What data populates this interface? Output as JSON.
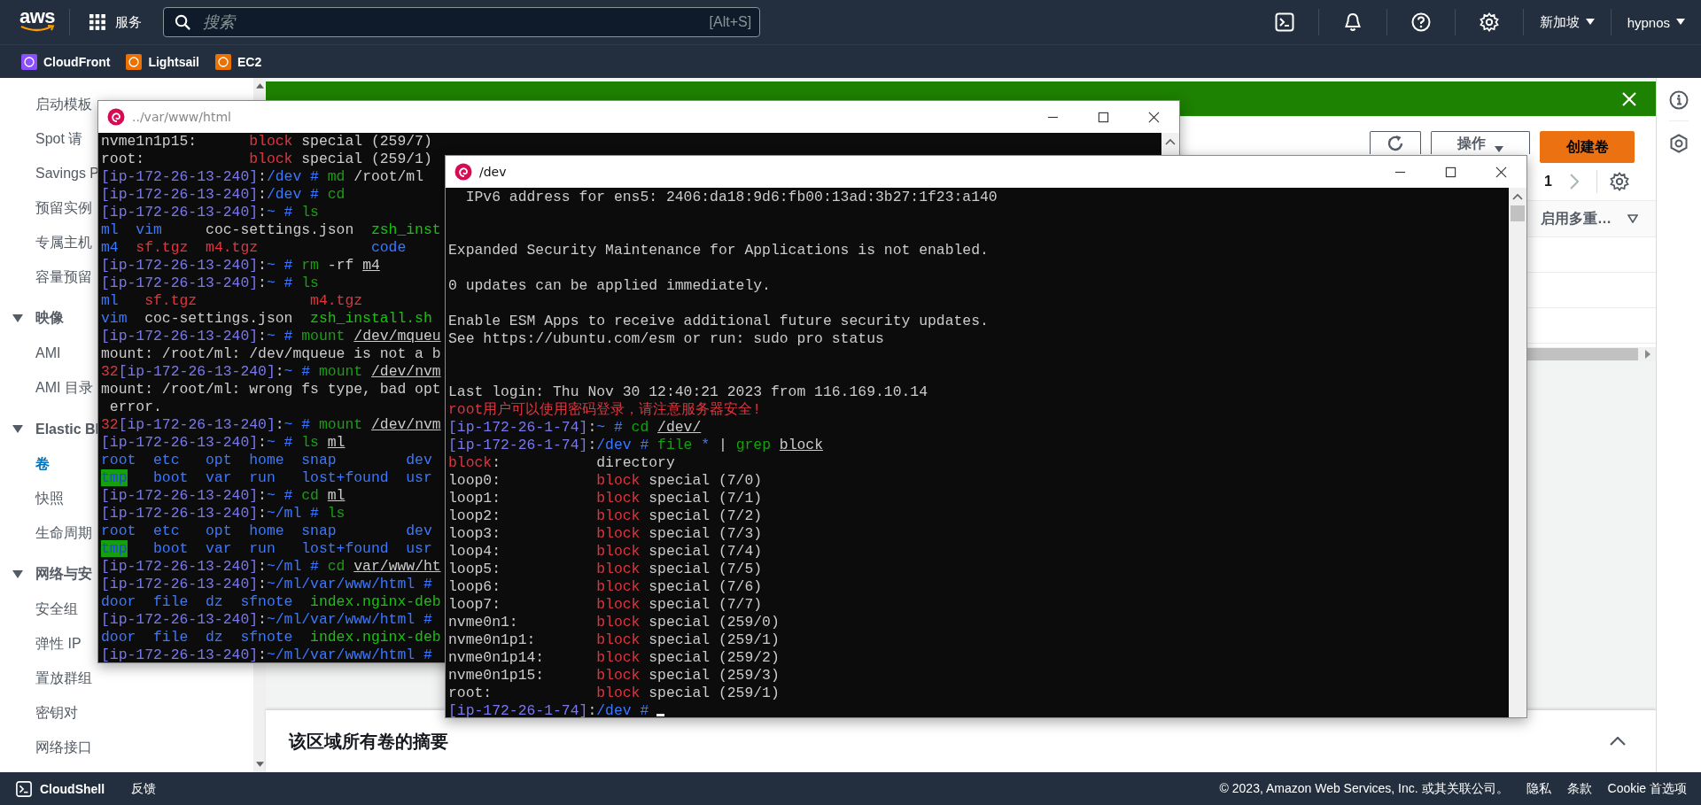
{
  "header": {
    "logo": "aws",
    "services": "服务",
    "search": {
      "placeholder": "搜索",
      "shortcut": "[Alt+S]"
    },
    "region": "新加坡",
    "user": "hypnos"
  },
  "favorites": [
    {
      "label": "CloudFront",
      "color": "#8c4fff"
    },
    {
      "label": "Lightsail",
      "color": "#ed7100"
    },
    {
      "label": "EC2",
      "color": "#ed7100"
    }
  ],
  "sidebar": {
    "items": [
      {
        "kind": "link",
        "label": "启动模板",
        "selected": false
      },
      {
        "kind": "link",
        "label": "Spot 请",
        "selected": false
      },
      {
        "kind": "link",
        "label": "Savings P",
        "selected": false
      },
      {
        "kind": "link",
        "label": "预留实例",
        "selected": false
      },
      {
        "kind": "link",
        "label": "专属主机",
        "selected": false
      },
      {
        "kind": "link",
        "label": "容量预留",
        "selected": false
      },
      {
        "kind": "section",
        "label": "映像",
        "expanded": true
      },
      {
        "kind": "link",
        "label": "AMI",
        "selected": false
      },
      {
        "kind": "link",
        "label": "AMI 目录",
        "selected": false
      },
      {
        "kind": "section",
        "label": "Elastic Bl",
        "expanded": true
      },
      {
        "kind": "link",
        "label": "卷",
        "selected": true
      },
      {
        "kind": "link",
        "label": "快照",
        "selected": false
      },
      {
        "kind": "link",
        "label": "生命周期",
        "selected": false
      },
      {
        "kind": "section",
        "label": "网络与安",
        "expanded": true
      },
      {
        "kind": "link",
        "label": "安全组",
        "selected": false
      },
      {
        "kind": "link",
        "label": "弹性 IP",
        "selected": false
      },
      {
        "kind": "link",
        "label": "置放群组",
        "selected": false
      },
      {
        "kind": "link",
        "label": "密钥对",
        "selected": false
      },
      {
        "kind": "link",
        "label": "网络接口",
        "selected": false
      }
    ]
  },
  "volumes": {
    "actions": "操作",
    "create": "创建卷",
    "page": "1",
    "column": "启用多重…"
  },
  "summary": {
    "title": "该区域所有卷的摘要"
  },
  "footer": {
    "cloudshell": "CloudShell",
    "feedback": "反馈",
    "copyright": "© 2023, Amazon Web Services, Inc. 或其关联公司。",
    "links": [
      "隐私",
      "条款",
      "Cookie 首选项"
    ]
  },
  "terminals": [
    {
      "title": "../var/www/html",
      "active": false,
      "cursor": false,
      "lines": [
        {
          "segs": [
            {
              "kind": "plain",
              "text": "nvme1n1p15:      "
            },
            {
              "kind": "red",
              "text": "block"
            },
            {
              "kind": "plain",
              "text": " special (259/7)"
            }
          ]
        },
        {
          "segs": [
            {
              "kind": "plain",
              "text": "root:            "
            },
            {
              "kind": "red",
              "text": "block"
            },
            {
              "kind": "plain",
              "text": " special (259/1)"
            }
          ]
        },
        {
          "segs": [
            {
              "kind": "prompt",
              "text": "[ip-172-26-13-240]"
            },
            {
              "kind": "plain",
              "text": ":"
            },
            {
              "kind": "path",
              "text": "/dev # "
            },
            {
              "kind": "command",
              "text": "md"
            },
            {
              "kind": "plain",
              "text": " /root/ml"
            }
          ]
        },
        {
          "segs": [
            {
              "kind": "prompt",
              "text": "[ip-172-26-13-240]"
            },
            {
              "kind": "plain",
              "text": ":"
            },
            {
              "kind": "path",
              "text": "/dev # "
            },
            {
              "kind": "command",
              "text": "cd"
            }
          ]
        },
        {
          "segs": [
            {
              "kind": "prompt",
              "text": "[ip-172-26-13-240]"
            },
            {
              "kind": "plain",
              "text": ":"
            },
            {
              "kind": "path",
              "text": "~ # "
            },
            {
              "kind": "command",
              "text": "ls"
            }
          ]
        },
        {
          "segs": [
            {
              "kind": "blue",
              "text": "ml  vim"
            },
            {
              "kind": "plain",
              "text": "     coc-settings.json  "
            },
            {
              "kind": "green",
              "text": "zsh_inst"
            }
          ]
        },
        {
          "segs": [
            {
              "kind": "blue",
              "text": "m4  "
            },
            {
              "kind": "red",
              "text": "sf.tgz  m4.tgz             "
            },
            {
              "kind": "blue",
              "text": "code"
            }
          ]
        },
        {
          "segs": [
            {
              "kind": "prompt",
              "text": "[ip-172-26-13-240]"
            },
            {
              "kind": "plain",
              "text": ":"
            },
            {
              "kind": "path",
              "text": "~ # "
            },
            {
              "kind": "command",
              "text": "rm"
            },
            {
              "kind": "plain",
              "text": " -rf "
            },
            {
              "kind": "underline",
              "text": "m4"
            }
          ]
        },
        {
          "segs": [
            {
              "kind": "prompt",
              "text": "[ip-172-26-13-240]"
            },
            {
              "kind": "plain",
              "text": ":"
            },
            {
              "kind": "path",
              "text": "~ # "
            },
            {
              "kind": "command",
              "text": "ls"
            }
          ]
        },
        {
          "segs": [
            {
              "kind": "blue",
              "text": "ml   "
            },
            {
              "kind": "red",
              "text": "sf.tgz             m4.tgz"
            }
          ]
        },
        {
          "segs": [
            {
              "kind": "blue",
              "text": "vim"
            },
            {
              "kind": "plain",
              "text": "  coc-settings.json  "
            },
            {
              "kind": "green",
              "text": "zsh_install.sh"
            }
          ]
        },
        {
          "segs": [
            {
              "kind": "prompt",
              "text": "[ip-172-26-13-240]"
            },
            {
              "kind": "plain",
              "text": ":"
            },
            {
              "kind": "path",
              "text": "~ # "
            },
            {
              "kind": "command",
              "text": "mount "
            },
            {
              "kind": "underline",
              "text": "/dev/mqueu"
            }
          ]
        },
        {
          "segs": [
            {
              "kind": "plain",
              "text": "mount: /root/ml: /dev/mqueue is not a b"
            }
          ]
        },
        {
          "segs": [
            {
              "kind": "red",
              "text": "32"
            },
            {
              "kind": "prompt",
              "text": "[ip-172-26-13-240]"
            },
            {
              "kind": "plain",
              "text": ":"
            },
            {
              "kind": "path",
              "text": "~ # "
            },
            {
              "kind": "command",
              "text": "mount "
            },
            {
              "kind": "underline",
              "text": "/dev/nvm"
            }
          ]
        },
        {
          "segs": [
            {
              "kind": "plain",
              "text": "mount: /root/ml: wrong fs type, bad opt"
            }
          ]
        },
        {
          "segs": [
            {
              "kind": "plain",
              "text": " error."
            }
          ]
        },
        {
          "segs": [
            {
              "kind": "red",
              "text": "32"
            },
            {
              "kind": "prompt",
              "text": "[ip-172-26-13-240]"
            },
            {
              "kind": "plain",
              "text": ":"
            },
            {
              "kind": "path",
              "text": "~ # "
            },
            {
              "kind": "command",
              "text": "mount "
            },
            {
              "kind": "underline",
              "text": "/dev/nvm"
            }
          ]
        },
        {
          "segs": [
            {
              "kind": "prompt",
              "text": "[ip-172-26-13-240]"
            },
            {
              "kind": "plain",
              "text": ":"
            },
            {
              "kind": "path",
              "text": "~ # "
            },
            {
              "kind": "command",
              "text": "ls "
            },
            {
              "kind": "underline",
              "text": "ml"
            }
          ]
        },
        {
          "segs": [
            {
              "kind": "blue",
              "text": "root  etc   opt  home  snap        dev"
            }
          ]
        },
        {
          "segs": [
            {
              "kind": "highlight",
              "text": "tmp"
            },
            {
              "kind": "blue",
              "text": "   boot  var  run   lost+found  usr"
            }
          ]
        },
        {
          "segs": [
            {
              "kind": "prompt",
              "text": "[ip-172-26-13-240]"
            },
            {
              "kind": "plain",
              "text": ":"
            },
            {
              "kind": "path",
              "text": "~ # "
            },
            {
              "kind": "command",
              "text": "cd "
            },
            {
              "kind": "underline",
              "text": "ml"
            }
          ]
        },
        {
          "segs": [
            {
              "kind": "prompt",
              "text": "[ip-172-26-13-240]"
            },
            {
              "kind": "plain",
              "text": ":"
            },
            {
              "kind": "path",
              "text": "~/ml # "
            },
            {
              "kind": "command",
              "text": "ls"
            }
          ]
        },
        {
          "segs": [
            {
              "kind": "blue",
              "text": "root  etc   opt  home  snap        dev"
            }
          ]
        },
        {
          "segs": [
            {
              "kind": "highlight",
              "text": "tmp"
            },
            {
              "kind": "blue",
              "text": "   boot  var  run   lost+found  usr"
            }
          ]
        },
        {
          "segs": [
            {
              "kind": "prompt",
              "text": "[ip-172-26-13-240]"
            },
            {
              "kind": "plain",
              "text": ":"
            },
            {
              "kind": "path",
              "text": "~/ml # "
            },
            {
              "kind": "command",
              "text": "cd "
            },
            {
              "kind": "underline",
              "text": "var/www/ht"
            }
          ]
        },
        {
          "segs": [
            {
              "kind": "prompt",
              "text": "[ip-172-26-13-240]"
            },
            {
              "kind": "plain",
              "text": ":"
            },
            {
              "kind": "path",
              "text": "~/ml/var/www/html #"
            }
          ]
        },
        {
          "segs": [
            {
              "kind": "blue",
              "text": "door  file  dz  sfnote  "
            },
            {
              "kind": "green",
              "text": "index.nginx-deb"
            }
          ]
        },
        {
          "segs": [
            {
              "kind": "prompt",
              "text": "[ip-172-26-13-240]"
            },
            {
              "kind": "plain",
              "text": ":"
            },
            {
              "kind": "path",
              "text": "~/ml/var/www/html #"
            }
          ]
        },
        {
          "segs": [
            {
              "kind": "blue",
              "text": "door  file  dz  sfnote  "
            },
            {
              "kind": "green",
              "text": "index.nginx-deb"
            }
          ]
        },
        {
          "segs": [
            {
              "kind": "prompt",
              "text": "[ip-172-26-13-240]"
            },
            {
              "kind": "plain",
              "text": ":"
            },
            {
              "kind": "path",
              "text": "~/ml/var/www/html #"
            }
          ]
        }
      ]
    },
    {
      "title": "/dev",
      "active": true,
      "cursor": true,
      "lines": [
        {
          "segs": [
            {
              "kind": "plain",
              "text": "  IPv6 address for ens5: 2406:da18:9d6:fb00:13ad:3b27:1f23:a140"
            }
          ]
        },
        {
          "kind": "after_two_blanks",
          "segs": [
            {
              "kind": "plain",
              "text": "Expanded Security Maintenance for Applications is not enabled."
            }
          ]
        },
        {
          "kind": "after_blank",
          "segs": [
            {
              "kind": "plain",
              "text": "0 updates can be applied immediately."
            }
          ]
        },
        {
          "kind": "after_blank",
          "segs": [
            {
              "kind": "plain",
              "text": "Enable ESM Apps to receive additional future security updates."
            }
          ]
        },
        {
          "segs": [
            {
              "kind": "plain",
              "text": "See https://ubuntu.com/esm or run: sudo pro status"
            }
          ]
        },
        {
          "kind": "after_two_blanks",
          "segs": [
            {
              "kind": "plain",
              "text": "Last login: Thu Nov 30 12:40:21 2023 from 116.169.10.14"
            }
          ]
        },
        {
          "segs": [
            {
              "kind": "red",
              "text": "root用户可以使用密码登录，请注意服务器安全!"
            }
          ]
        },
        {
          "segs": [
            {
              "kind": "prompt",
              "text": "[ip-172-26-1-74]"
            },
            {
              "kind": "plain",
              "text": ":"
            },
            {
              "kind": "path",
              "text": "~ # "
            },
            {
              "kind": "command",
              "text": "cd "
            },
            {
              "kind": "underline",
              "text": "/dev/"
            }
          ]
        },
        {
          "segs": [
            {
              "kind": "prompt",
              "text": "[ip-172-26-1-74]"
            },
            {
              "kind": "plain",
              "text": ":"
            },
            {
              "kind": "path",
              "text": "/dev # "
            },
            {
              "kind": "command",
              "text": "file "
            },
            {
              "kind": "blue",
              "text": "* "
            },
            {
              "kind": "plain",
              "text": "| "
            },
            {
              "kind": "command",
              "text": "grep "
            },
            {
              "kind": "underline",
              "text": "block"
            }
          ]
        },
        {
          "segs": [
            {
              "kind": "red",
              "text": "block"
            },
            {
              "kind": "plain",
              "text": ":           directory"
            }
          ]
        },
        {
          "segs": [
            {
              "kind": "plain",
              "text": "loop0:           "
            },
            {
              "kind": "red",
              "text": "block"
            },
            {
              "kind": "plain",
              "text": " special (7/0)"
            }
          ]
        },
        {
          "segs": [
            {
              "kind": "plain",
              "text": "loop1:           "
            },
            {
              "kind": "red",
              "text": "block"
            },
            {
              "kind": "plain",
              "text": " special (7/1)"
            }
          ]
        },
        {
          "segs": [
            {
              "kind": "plain",
              "text": "loop2:           "
            },
            {
              "kind": "red",
              "text": "block"
            },
            {
              "kind": "plain",
              "text": " special (7/2)"
            }
          ]
        },
        {
          "segs": [
            {
              "kind": "plain",
              "text": "loop3:           "
            },
            {
              "kind": "red",
              "text": "block"
            },
            {
              "kind": "plain",
              "text": " special (7/3)"
            }
          ]
        },
        {
          "segs": [
            {
              "kind": "plain",
              "text": "loop4:           "
            },
            {
              "kind": "red",
              "text": "block"
            },
            {
              "kind": "plain",
              "text": " special (7/4)"
            }
          ]
        },
        {
          "segs": [
            {
              "kind": "plain",
              "text": "loop5:           "
            },
            {
              "kind": "red",
              "text": "block"
            },
            {
              "kind": "plain",
              "text": " special (7/5)"
            }
          ]
        },
        {
          "segs": [
            {
              "kind": "plain",
              "text": "loop6:           "
            },
            {
              "kind": "red",
              "text": "block"
            },
            {
              "kind": "plain",
              "text": " special (7/6)"
            }
          ]
        },
        {
          "segs": [
            {
              "kind": "plain",
              "text": "loop7:           "
            },
            {
              "kind": "red",
              "text": "block"
            },
            {
              "kind": "plain",
              "text": " special (7/7)"
            }
          ]
        },
        {
          "segs": [
            {
              "kind": "plain",
              "text": "nvme0n1:         "
            },
            {
              "kind": "red",
              "text": "block"
            },
            {
              "kind": "plain",
              "text": " special (259/0)"
            }
          ]
        },
        {
          "segs": [
            {
              "kind": "plain",
              "text": "nvme0n1p1:       "
            },
            {
              "kind": "red",
              "text": "block"
            },
            {
              "kind": "plain",
              "text": " special (259/1)"
            }
          ]
        },
        {
          "segs": [
            {
              "kind": "plain",
              "text": "nvme0n1p14:      "
            },
            {
              "kind": "red",
              "text": "block"
            },
            {
              "kind": "plain",
              "text": " special (259/2)"
            }
          ]
        },
        {
          "segs": [
            {
              "kind": "plain",
              "text": "nvme0n1p15:      "
            },
            {
              "kind": "red",
              "text": "block"
            },
            {
              "kind": "plain",
              "text": " special (259/3)"
            }
          ]
        },
        {
          "segs": [
            {
              "kind": "plain",
              "text": "root:            "
            },
            {
              "kind": "red",
              "text": "block"
            },
            {
              "kind": "plain",
              "text": " special (259/1)"
            }
          ]
        },
        {
          "segs": [
            {
              "kind": "prompt",
              "text": "[ip-172-26-1-74]"
            },
            {
              "kind": "plain",
              "text": ":"
            },
            {
              "kind": "path",
              "text": "/dev #"
            }
          ]
        }
      ]
    }
  ]
}
